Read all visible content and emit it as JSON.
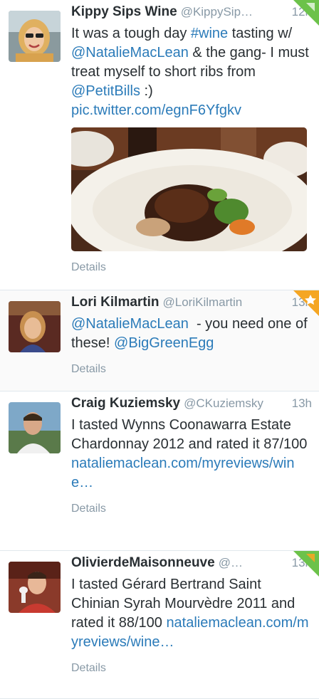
{
  "tweets": [
    {
      "fullname": "Kippy Sips Wine",
      "handle": "@KippySip…",
      "time": "12h",
      "text_parts": [
        "It was a tough day ",
        "#wine",
        " tasting w/ ",
        "@NatalieMacLean",
        " & the gang- I must treat myself to short ribs from ",
        "@PetitBills",
        " :) ",
        "pic.twitter.com/egnF6Yfgkv"
      ],
      "details": "Details"
    },
    {
      "fullname": "Lori Kilmartin",
      "handle": "@LoriKilmartin",
      "time": "13h",
      "text_parts": [
        "@NatalieMacLean",
        "  - you need one of these! ",
        "@BigGreenEgg"
      ],
      "details": "Details"
    },
    {
      "fullname": "Craig Kuziemsky",
      "handle": "@CKuziemsky",
      "time": "13h",
      "text_parts": [
        "I tasted Wynns Coonawarra Estate Chardonnay 2012 and rated it 87/100 ",
        "nataliemaclean.com/myreviews/wine…"
      ],
      "details": "Details"
    },
    {
      "fullname": "OlivierdeMaisonneuve",
      "handle": "@…",
      "time": "13h",
      "text_parts": [
        "I tasted Gérard Bertrand Saint Chinian Syrah Mourvèdre 2011 and rated it 88/100 ",
        "nataliemaclean.com/myreviews/wine…"
      ],
      "details": "Details"
    }
  ],
  "colors": {
    "link": "#2b7bb9",
    "name": "#292f33",
    "meta": "#8899a6",
    "follow_corner_orange": "#f5a623",
    "follow_corner_green": "#6cc24a"
  }
}
